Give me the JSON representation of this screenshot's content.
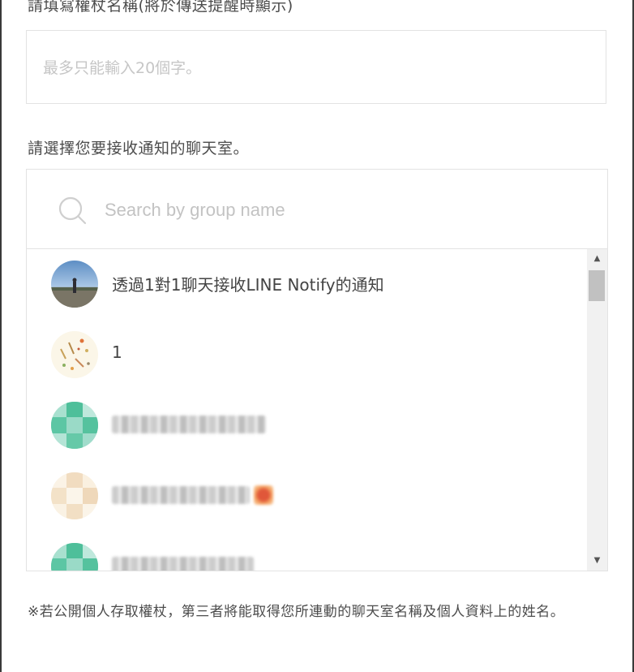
{
  "token_name": {
    "label": "請填寫權杖名稱(將於傳送提醒時顯示)",
    "placeholder": "最多只能輸入20個字。"
  },
  "room_select": {
    "label": "請選擇您要接收通知的聊天室。",
    "search_placeholder": "Search by group name"
  },
  "rooms": [
    {
      "name": "透過1對1聊天接收LINE Notify的通知",
      "avatar": "photo-avatar"
    },
    {
      "name": "1",
      "avatar": "doodle-avatar"
    },
    {
      "name": "",
      "avatar": "green-avatar"
    },
    {
      "name": "",
      "avatar": "beige-avatar"
    },
    {
      "name": "",
      "avatar": "green-avatar"
    }
  ],
  "note": "※若公開個人存取權杖，第三者將能取得您所連動的聊天室名稱及個人資料上的姓名。",
  "colors": {
    "border": "#e3e3e3",
    "placeholder": "#c6c6c6",
    "text": "#4c4c4c"
  }
}
